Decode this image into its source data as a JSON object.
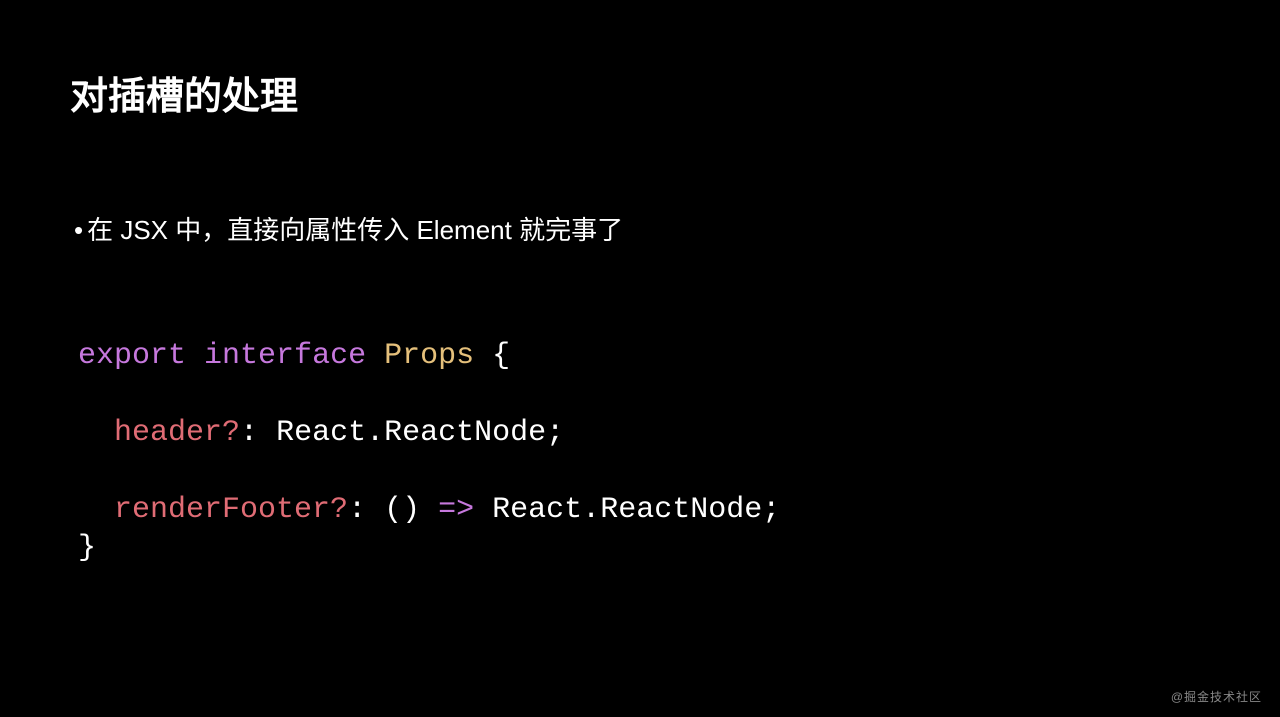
{
  "slide": {
    "title": "对插槽的处理",
    "bullet": "在 JSX 中，直接向属性传入 Element 就完事了",
    "code": {
      "line1": {
        "export": "export",
        "interface": "interface",
        "type": "Props",
        "open": "{"
      },
      "line2_blank": " ",
      "line3": {
        "indent": "  ",
        "prop": "header?",
        "colon": ":",
        "space": " ",
        "val": "React.ReactNode",
        "semi": ";"
      },
      "line4_blank": " ",
      "line5": {
        "indent": "  ",
        "prop": "renderFooter?",
        "colon": ":",
        "space": " ",
        "lparen": "(",
        "rparen": ")",
        "arrow": "=>",
        "val": "React.ReactNode",
        "semi": ";"
      },
      "line6": {
        "close": "}"
      }
    }
  },
  "watermark": "@掘金技术社区"
}
